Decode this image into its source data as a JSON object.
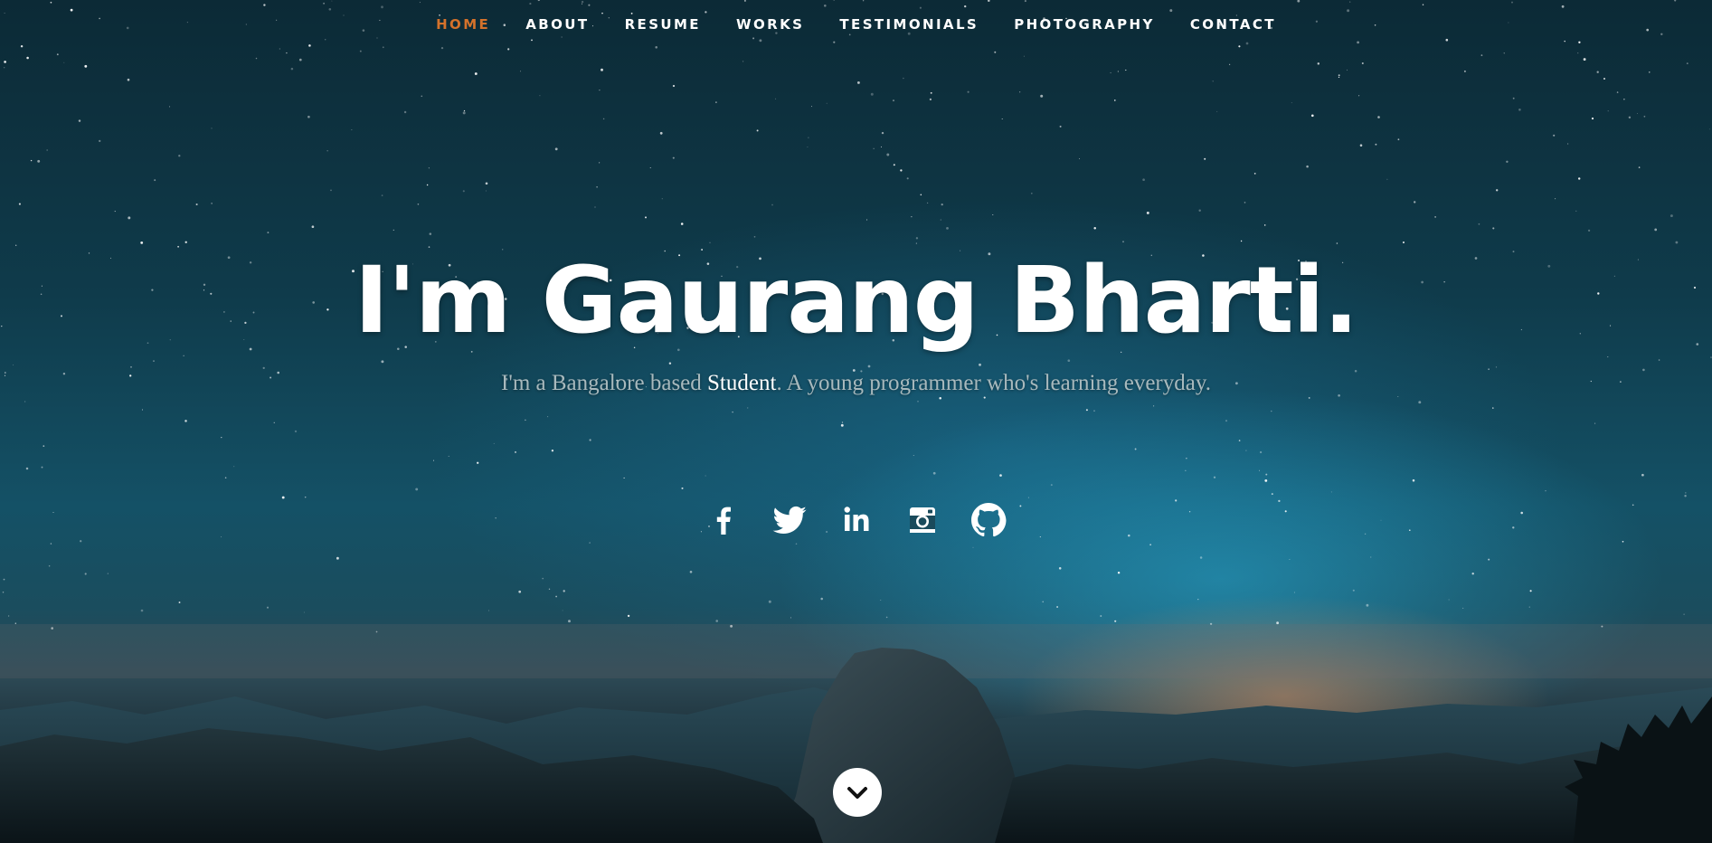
{
  "nav": {
    "items": [
      {
        "label": "HOME",
        "active": true
      },
      {
        "label": "ABOUT",
        "active": false
      },
      {
        "label": "RESUME",
        "active": false
      },
      {
        "label": "WORKS",
        "active": false
      },
      {
        "label": "TESTIMONIALS",
        "active": false
      },
      {
        "label": "PHOTOGRAPHY",
        "active": false
      },
      {
        "label": "CONTACT",
        "active": false
      }
    ]
  },
  "banner": {
    "headline": "I'm Gaurang Bharti.",
    "intro_before": "I'm a Bangalore based ",
    "intro_highlight": "Student",
    "intro_after": ". A young programmer who's learning everyday."
  },
  "social": {
    "icons": [
      "facebook-icon",
      "twitter-icon",
      "linkedin-icon",
      "instagram-icon",
      "github-icon"
    ]
  },
  "scroll": {
    "icon": "chevron-down-icon"
  },
  "colors": {
    "accent": "#d4722b",
    "text": "#ffffff",
    "intro_text": "#a8b9bd"
  }
}
